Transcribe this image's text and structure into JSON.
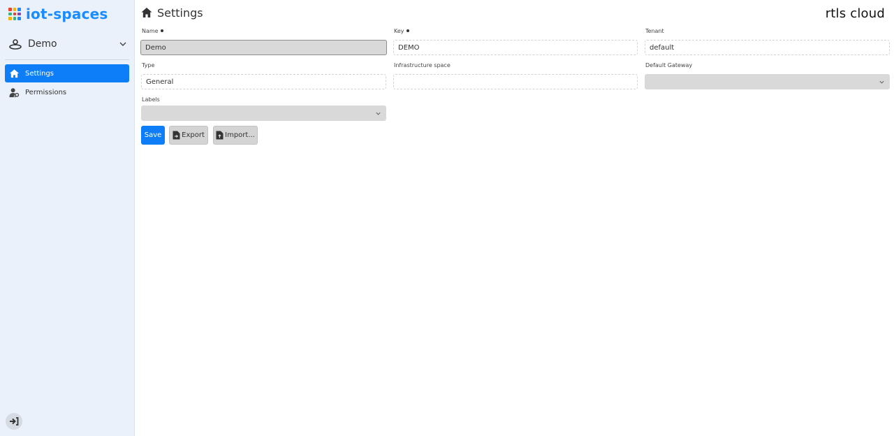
{
  "sidebar": {
    "brand": "iot-spaces",
    "brand_icon": "grid-logo-icon",
    "brand_colors": [
      "#e8432c",
      "#f6b400",
      "#1a8cff",
      "#36b37e",
      "#e8432c",
      "#8e44ad",
      "#f6b400",
      "#36b37e",
      "#1a8cff"
    ],
    "space": {
      "name": "Demo",
      "icon": "space-icon"
    },
    "nav": [
      {
        "label": "Settings",
        "icon": "home-icon",
        "active": true
      },
      {
        "label": "Permissions",
        "icon": "user-key-icon",
        "active": false
      }
    ],
    "logout_icon": "sign-in-arrow-icon"
  },
  "header": {
    "title": "Settings",
    "icon": "home-icon",
    "logo": "rtls cloud"
  },
  "form": {
    "name": {
      "label": "Name",
      "value": "Demo",
      "required": true
    },
    "key": {
      "label": "Key",
      "value": "DEMO",
      "required": true
    },
    "tenant": {
      "label": "Tenant",
      "value": "default"
    },
    "type": {
      "label": "Type",
      "value": "General"
    },
    "infrastructure_space": {
      "label": "Infrastructure space",
      "value": ""
    },
    "default_gateway": {
      "label": "Default Gateway",
      "value": ""
    },
    "labels": {
      "label": "Labels",
      "value": ""
    }
  },
  "actions": {
    "save": "Save",
    "export": "Export",
    "import": "Import..."
  },
  "colors": {
    "accent": "#0d7ef7",
    "sidebar_bg": "#eaf1fb",
    "disabled_bg": "#d9d9d9"
  }
}
